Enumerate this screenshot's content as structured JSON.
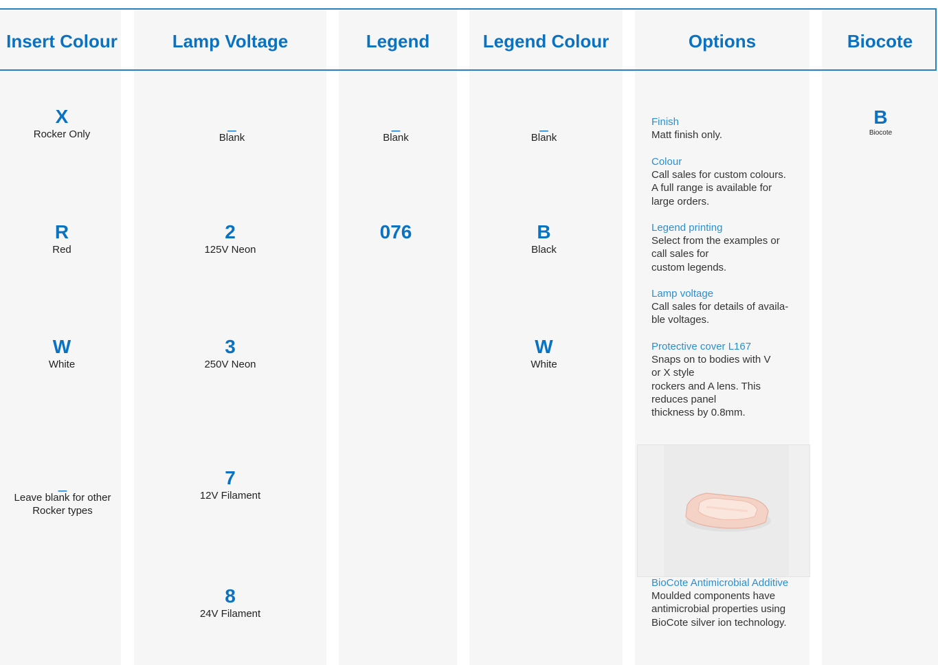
{
  "headers": [
    "Insert Colour",
    "Lamp Voltage",
    "Legend",
    "Legend Colour",
    "Options",
    "Biocote"
  ],
  "insert_colour": [
    {
      "code": "X",
      "desc": "Rocker Only"
    },
    {
      "code": "R",
      "desc": "Red"
    },
    {
      "code": "W",
      "desc": "White"
    },
    {
      "code": "_",
      "desc_line1": "Leave blank for other",
      "desc_line2": "Rocker types"
    }
  ],
  "lamp_voltage": [
    {
      "code": "_",
      "desc": "Blank"
    },
    {
      "code": "2",
      "desc": "125V Neon"
    },
    {
      "code": "3",
      "desc": "250V Neon"
    },
    {
      "code": "7",
      "desc": "12V Filament"
    },
    {
      "code": "8",
      "desc": "24V Filament"
    }
  ],
  "legend": [
    {
      "code": "_",
      "desc": "Blank"
    },
    {
      "code": "076"
    }
  ],
  "legend_colour": [
    {
      "code": "_",
      "desc": "Blank"
    },
    {
      "code": "B",
      "desc": "Black"
    },
    {
      "code": "W",
      "desc": "White"
    }
  ],
  "options": [
    {
      "heading": "Finish",
      "text": "Matt finish only."
    },
    {
      "heading": "Colour",
      "text": "Call sales for custom colours.\nA full range is available for\nlarge orders."
    },
    {
      "heading": "Legend printing",
      "text": "Select from the examples or\ncall sales for\ncustom legends."
    },
    {
      "heading": "Lamp voltage",
      "text": "Call sales for details of availa-\nble voltages."
    },
    {
      "heading": "Protective cover L167",
      "text": "Snaps on to bodies with V\nor X style\nrockers and A lens. This\nreduces panel\nthickness by 0.8mm."
    },
    {
      "heading": "BioCote Antimicrobial Additive",
      "text": "Moulded components have\nantimicrobial properties using\nBioCote silver ion technology."
    }
  ],
  "biocote": [
    {
      "code": "B",
      "desc": "Biocote"
    }
  ],
  "colors": {
    "accent": "#0a72c0",
    "link": "#2a8fd0",
    "column_bg": "#f6f6f6"
  }
}
